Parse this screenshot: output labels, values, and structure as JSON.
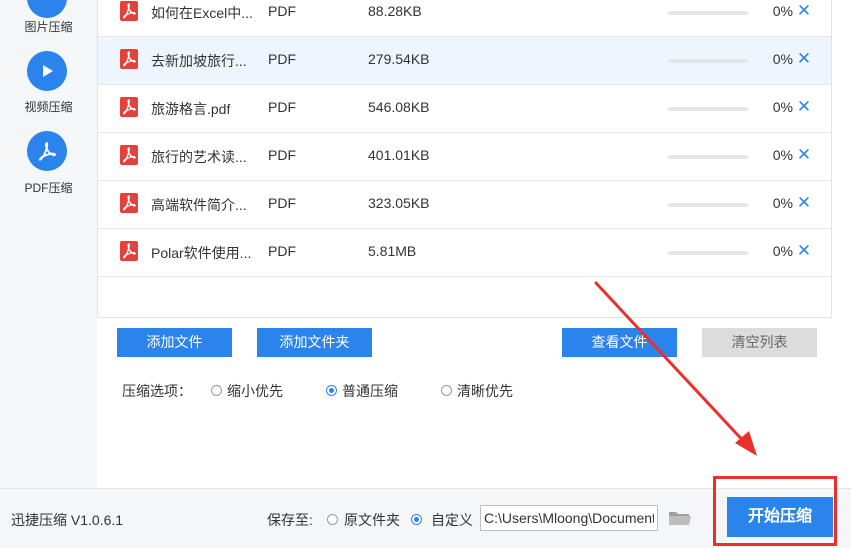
{
  "sidebar": {
    "items": [
      {
        "label": "图片压缩",
        "icon": "image-compress-icon"
      },
      {
        "label": "视频压缩",
        "icon": "play-icon"
      },
      {
        "label": "PDF压缩",
        "icon": "pdf-icon"
      }
    ]
  },
  "file_list": {
    "rows": [
      {
        "name": "如何在Excel中...",
        "type": "PDF",
        "size": "88.28KB",
        "percent": "0%",
        "progress": 0
      },
      {
        "name": "去新加坡旅行...",
        "type": "PDF",
        "size": "279.54KB",
        "percent": "0%",
        "progress": 0
      },
      {
        "name": "旅游格言.pdf",
        "type": "PDF",
        "size": "546.08KB",
        "percent": "0%",
        "progress": 0
      },
      {
        "name": "旅行的艺术读...",
        "type": "PDF",
        "size": "401.01KB",
        "percent": "0%",
        "progress": 0
      },
      {
        "name": "高端软件简介...",
        "type": "PDF",
        "size": "323.05KB",
        "percent": "0%",
        "progress": 0
      },
      {
        "name": "Polar软件使用...",
        "type": "PDF",
        "size": "5.81MB",
        "percent": "0%",
        "progress": 0
      }
    ],
    "remove_glyph": "✕"
  },
  "actions": {
    "add_file": "添加文件",
    "add_folder": "添加文件夹",
    "view_file": "查看文件",
    "clear_list": "清空列表"
  },
  "options": {
    "label": "压缩选项：",
    "choices": [
      "缩小优先",
      "普通压缩",
      "清晰优先"
    ],
    "selected": 1
  },
  "footer": {
    "version": "迅捷压缩 V1.0.6.1",
    "save_to_label": "保存至:",
    "save_choices": [
      "原文件夹",
      "自定义"
    ],
    "save_selected": 1,
    "path_value": "C:\\Users\\Mloong\\Documents",
    "start_button": "开始压缩"
  },
  "colors": {
    "accent": "#2b83ec",
    "pdf_red": "#e0433b",
    "annotation_red": "#e8312a"
  }
}
